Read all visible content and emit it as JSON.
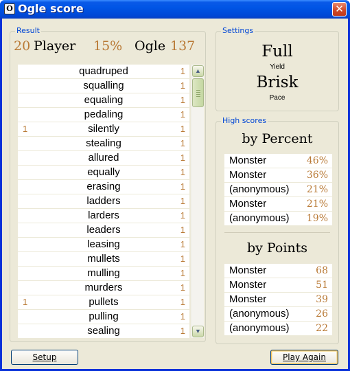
{
  "window": {
    "title": "Ogle score",
    "icon_letter": "O",
    "close_glyph": "✕"
  },
  "result": {
    "label": "Result",
    "player_score": "20",
    "player_name": "Player",
    "percent": "15%",
    "ogle_name": "Ogle",
    "ogle_score": "137",
    "words": [
      {
        "left": "",
        "word": "quadruped",
        "right": "1"
      },
      {
        "left": "",
        "word": "squalling",
        "right": "1"
      },
      {
        "left": "",
        "word": "equaling",
        "right": "1"
      },
      {
        "left": "",
        "word": "pedaling",
        "right": "1"
      },
      {
        "left": "1",
        "word": "silently",
        "right": "1"
      },
      {
        "left": "",
        "word": "stealing",
        "right": "1"
      },
      {
        "left": "",
        "word": "allured",
        "right": "1"
      },
      {
        "left": "",
        "word": "equally",
        "right": "1"
      },
      {
        "left": "",
        "word": "erasing",
        "right": "1"
      },
      {
        "left": "",
        "word": "ladders",
        "right": "1"
      },
      {
        "left": "",
        "word": "larders",
        "right": "1"
      },
      {
        "left": "",
        "word": "leaders",
        "right": "1"
      },
      {
        "left": "",
        "word": "leasing",
        "right": "1"
      },
      {
        "left": "",
        "word": "mullets",
        "right": "1"
      },
      {
        "left": "",
        "word": "mulling",
        "right": "1"
      },
      {
        "left": "",
        "word": "murders",
        "right": "1"
      },
      {
        "left": "1",
        "word": "pullets",
        "right": "1"
      },
      {
        "left": "",
        "word": "pulling",
        "right": "1"
      },
      {
        "left": "",
        "word": "sealing",
        "right": "1"
      }
    ]
  },
  "settings": {
    "label": "Settings",
    "yield_value": "Full",
    "yield_label": "Yield",
    "pace_value": "Brisk",
    "pace_label": "Pace"
  },
  "high_scores": {
    "label": "High scores",
    "by_percent_heading": "by Percent",
    "by_percent": [
      {
        "name": "Monster",
        "value": "46%"
      },
      {
        "name": "Monster",
        "value": "36%"
      },
      {
        "name": "(anonymous)",
        "value": "21%"
      },
      {
        "name": "Monster",
        "value": "21%"
      },
      {
        "name": "(anonymous)",
        "value": "19%"
      }
    ],
    "by_points_heading": "by Points",
    "by_points": [
      {
        "name": "Monster",
        "value": "68"
      },
      {
        "name": "Monster",
        "value": "51"
      },
      {
        "name": "Monster",
        "value": "39"
      },
      {
        "name": "(anonymous)",
        "value": "26"
      },
      {
        "name": "(anonymous)",
        "value": "22"
      }
    ]
  },
  "buttons": {
    "setup": "Setup",
    "play_again": "Play Again"
  },
  "colors": {
    "score_accent": "#b97a36",
    "group_label": "#0046d5",
    "dialog_bg": "#ece9d8"
  }
}
